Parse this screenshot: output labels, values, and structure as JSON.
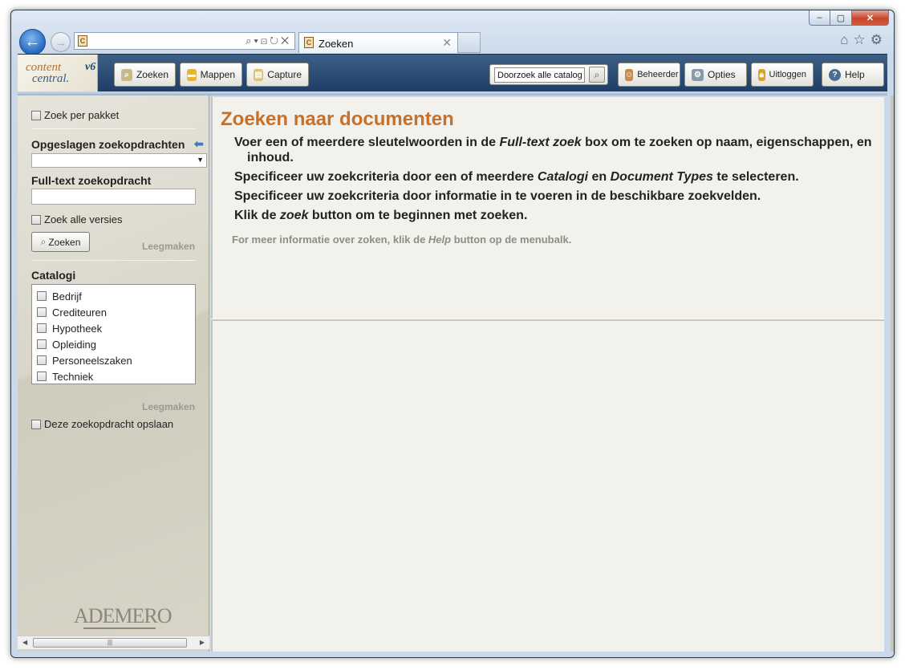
{
  "browser": {
    "tab_title": "Zoeken",
    "controls": {
      "minimize": "–",
      "maximize": "▢",
      "close": "✕"
    }
  },
  "app": {
    "logo_line1": "content",
    "logo_line2": "central.",
    "version": "v6"
  },
  "toolbar": {
    "zoeken_label": "Zoeken",
    "mappen_label": "Mappen",
    "capture_label": "Capture",
    "search_placeholder": "Doorzoek alle catalogi",
    "beheerder_label": "Beheerder",
    "opties_label": "Opties",
    "uitloggen_label": "Uitloggen",
    "help_label": "Help"
  },
  "sidebar": {
    "zoek_per_pakket": "Zoek per pakket",
    "saved_searches_title": "Opgeslagen zoekopdrachten",
    "fulltext_title": "Full-text zoekopdracht",
    "zoek_alle_versies": "Zoek alle versies",
    "zoeken_button": "Zoeken",
    "leegmaken_1": "Leegmaken",
    "catalogi_title": "Catalogi",
    "catalogi": [
      "Bedrijf",
      "Crediteuren",
      "Hypotheek",
      "Opleiding",
      "Personeelszaken",
      "Techniek"
    ],
    "leegmaken_2": "Leegmaken",
    "save_search": "Deze zoekopdracht opslaan",
    "brand": "ADEMERO"
  },
  "main": {
    "title": "Zoeken naar documenten",
    "line1_a": "Voer een of meerdere sleutelwoorden in de ",
    "line1_em": "Full-text zoek",
    "line1_b": " box om te zoeken op naam, eigenschappen, en inhoud.",
    "line2_a": "Specificeer uw zoekcriteria door een of meerdere ",
    "line2_em1": "Catalogi",
    "line2_mid": " en ",
    "line2_em2": "Document Types",
    "line2_b": " te selecteren.",
    "line3": "Specificeer uw zoekcriteria door informatie in te voeren in de beschikbare zoekvelden.",
    "line4_a": "Klik de ",
    "line4_em": "zoek",
    "line4_b": " button om te beginnen met zoeken.",
    "info_a": "For meer informatie over zoken, klik de ",
    "info_em": "Help",
    "info_b": " button op de menubalk."
  }
}
